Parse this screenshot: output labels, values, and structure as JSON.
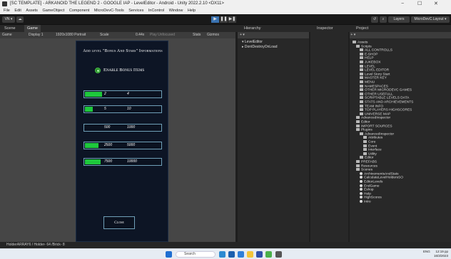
{
  "window": {
    "title": "[SC TEMPLATE] - ARKANOID THE LEGEND 2 - GOOGLE IAP - LevelEditor - Android - Unity 2022.2.10 <DX11>",
    "minimize": "−",
    "maximize": "☐",
    "close": "✕"
  },
  "menu": [
    "File",
    "Edit",
    "Assets",
    "GameObject",
    "Component",
    "MicroDevC-Tools",
    "Services",
    "InControl",
    "Window",
    "Help"
  ],
  "toolbar": {
    "account": "VN ▾",
    "cloud": "☁",
    "layers": "Layers",
    "layout": "MicroDevC.Layout ▾"
  },
  "tabs": {
    "scene": "Scene",
    "game": "Game",
    "hierarchy": "Hierarchy",
    "inspector": "Inspector",
    "project": "Project"
  },
  "gamebar": {
    "mode": "Game",
    "display": "Display 1",
    "resolution": "1920x1080 Portrait",
    "scale_label": "Scale",
    "scale_value": "0.44x",
    "play_mode": "Play Unfocused",
    "stats": "Stats",
    "gizmos": "Gizmos"
  },
  "game_panel": {
    "title": "Add level \"Bonus And Stars\" Informations",
    "toggle_label": "Enable Bonus Items",
    "rows": [
      {
        "a": "2",
        "b": "4",
        "fill": 0.22
      },
      {
        "a": "5",
        "b": "10",
        "fill": 0.1
      },
      {
        "a": "500",
        "b": "1000",
        "fill": 0.0
      },
      {
        "a": "2500",
        "b": "5000",
        "fill": 0.18
      },
      {
        "a": "7500",
        "b": "10000",
        "fill": 0.2
      }
    ],
    "close": "Close"
  },
  "hierarchy": {
    "items": [
      "LevelEditor",
      "DontDestroyOnLoad"
    ]
  },
  "project": {
    "assets_label": "Assets",
    "scripts_label": "Scripts",
    "scripts_children": [
      "ALL CONTROLLS",
      "E-SHOP",
      "HELP",
      "JUKEBOX",
      "LEVEL",
      "LEVEL EDITOR",
      "Level Story Start",
      "MASTER KEY",
      "MENU",
      "NAMESPACES",
      "OTHER MICRODEVC GAMES",
      "OTHER USEFULL",
      "SCRIPTABLE LEVELS DATA",
      "STATS AND ARCHIEVEMENTS",
      "TEAM INFO",
      "TOP PLAYERS HIGHSCORES",
      "UNIVERSE MAP"
    ],
    "other_folders": [
      "AdvancedInspector",
      "Editor",
      "IMPORT SOURCES",
      "Plugins"
    ],
    "plugins_children": [
      "AdvancedInspector",
      "Attributes",
      "Core",
      "Event",
      "Interface",
      "Utility",
      "Editor"
    ],
    "more_folders": [
      "PREFABS",
      "Resources",
      "Scenes"
    ],
    "scenes": [
      "ArchivementsAndStats",
      "CalculateLevelHoldersSO",
      "EditorLevels",
      "EndGame",
      "Eshop",
      "Help",
      "HighScores",
      "Intro"
    ]
  },
  "status": "HolderARRAY6 / Holder- 64 /Brick- 8",
  "taskbar": {
    "search": "Search",
    "lang": "ENG",
    "time": "12:19 pp",
    "date": "16/3/2023"
  }
}
